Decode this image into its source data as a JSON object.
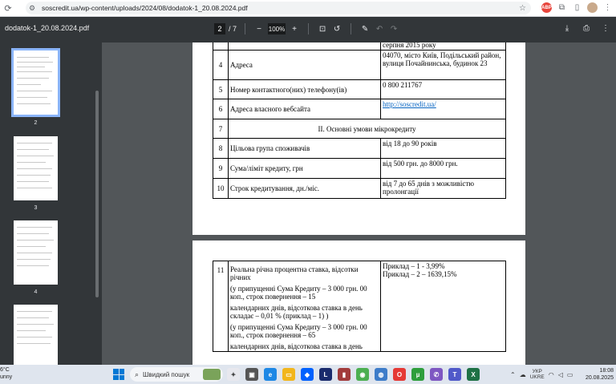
{
  "browser": {
    "url": "soscredit.ua/wp-content/uploads/2024/08/dodatok-1_20.08.2024.pdf"
  },
  "pdf": {
    "filename": "dodatok-1_20.08.2024.pdf",
    "current_page": "2",
    "total_pages": "/ 7",
    "zoom": "100%"
  },
  "thumbnails": [
    {
      "label": "2",
      "selected": true
    },
    {
      "label": "3",
      "selected": false
    },
    {
      "label": "4",
      "selected": false
    },
    {
      "label": ""
    }
  ],
  "page1": {
    "top_partial": "серпня 2015 року",
    "rows": [
      {
        "num": "4",
        "label": "Адреса",
        "value": "04070, місто Київ, Подільський район, вулиця Почайнинська, будинок 23"
      },
      {
        "num": "5",
        "label": "Номер контактного(них) телефону(ів)",
        "value": "0 800 211767"
      },
      {
        "num": "6",
        "label": "Адреса власного вебсайта",
        "value": "http://soscredit.ua/"
      },
      {
        "num": "7",
        "label": "II. Основні умови мікрокредиту",
        "value": ""
      },
      {
        "num": "8",
        "label": "Цільова група споживачів",
        "value": "від 18 до 90 років"
      },
      {
        "num": "9",
        "label": "Сума/ліміт кредиту, грн",
        "value": "від 500 грн. до 8000 грн."
      },
      {
        "num": "10",
        "label": "Строк кредитування, дн./міс.",
        "value": "від 7 до 65 днів з можливістю пролонгації"
      }
    ]
  },
  "page2": {
    "num": "11",
    "label_lines": [
      "Реальна річна процентна ставка, відсотки річних",
      "(у припущенні Сума Кредиту – 3 000 грн. 00 коп., строк повернення – 15",
      "календарних днів, відсоткова ставка в день складає – 0,01 % (приклад – 1) )",
      "(у припущенні Сума Кредиту – 3 000 грн. 00 коп., строк повернення – 65",
      "календарних днів, відсоткова ставка в день"
    ],
    "value_lines": [
      "Приклад – 1 - 3,99%",
      "Приклад – 2 – 1639,15%"
    ]
  },
  "taskbar": {
    "weather_temp": "6°C",
    "weather_desc": "unny",
    "search_placeholder": "Швидкий пошук",
    "lang_top": "УКР",
    "lang_bottom": "UKRE",
    "time": "18:08",
    "date": "20.08.2025"
  }
}
